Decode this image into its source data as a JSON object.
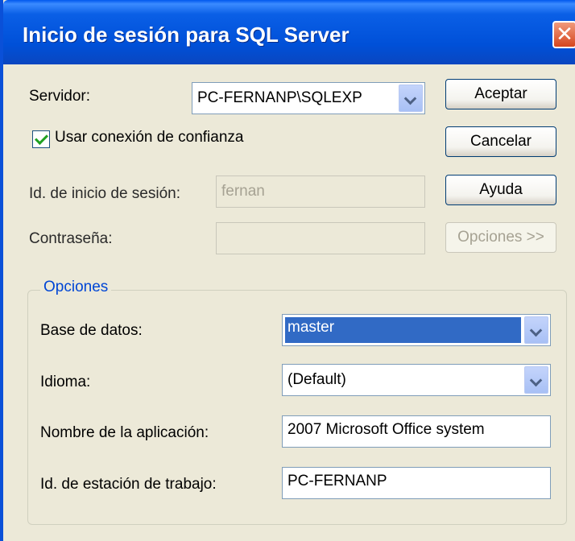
{
  "window": {
    "title": "Inicio de sesión para SQL Server"
  },
  "login": {
    "server_label": "Servidor:",
    "server_value": "PC-FERNANP\\SQLEXP",
    "trusted_label": "Usar conexión de confianza",
    "trusted_checked": true,
    "login_id_label": "Id. de inicio de sesión:",
    "login_id_value": "fernan",
    "password_label": "Contraseña:",
    "password_value": ""
  },
  "buttons": {
    "accept": "Aceptar",
    "cancel": "Cancelar",
    "help": "Ayuda",
    "options": "Opciones >>"
  },
  "options": {
    "group_label": "Opciones",
    "database_label": "Base de datos:",
    "database_value": "master",
    "language_label": "Idioma:",
    "language_value": "(Default)",
    "app_name_label": "Nombre de la aplicación:",
    "app_name_value": "2007 Microsoft Office system",
    "workstation_label": "Id. de estación de trabajo:",
    "workstation_value": "PC-FERNANP"
  },
  "colors": {
    "titlebar": "#0a5fe6",
    "window_bg": "#ece9d8",
    "selection": "#316ac5",
    "group_label": "#0046d5",
    "close": "#d6451e"
  },
  "icons": {
    "close": "close-icon",
    "dropdown": "chevron-down-icon",
    "check": "check-icon"
  }
}
